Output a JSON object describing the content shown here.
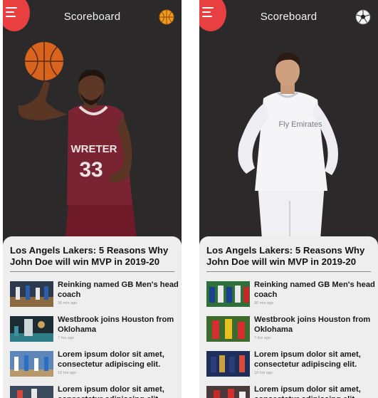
{
  "screens": [
    {
      "id": "left",
      "header": {
        "title": "Scoreboard",
        "sport_icon": "basketball-icon"
      },
      "hero": {
        "jersey_text": "WRETER",
        "jersey_number": "33"
      },
      "featured": {
        "headline": "Los Angels Lakers: 5 Reasons Why John Doe  will win MVP in 2019-20"
      },
      "news": [
        {
          "title": "Reinking named GB Men's head coach",
          "time": "30 min ago"
        },
        {
          "title": "Westbrook joins Houston from Oklohama",
          "time": "7 hrs ago"
        },
        {
          "title": "Lorem ipsum dolor sit amet, consectetur adipiscing elit.",
          "time": "10 hrs ago"
        },
        {
          "title": "Lorem ipsum dolor sit amet, consectetur adipiscing elit.",
          "time": ""
        }
      ],
      "colors": {
        "accent": "#e84040",
        "background": "#2b2929",
        "card": "#efeeee"
      }
    },
    {
      "id": "right",
      "header": {
        "title": "Scoreboard",
        "sport_icon": "soccer-ball-icon"
      },
      "hero": {
        "jersey_text": "Fly Emirates"
      },
      "featured": {
        "headline": "Los Angels Lakers: 5 Reasons Why John Doe  will win MVP in 2019-20"
      },
      "news": [
        {
          "title": "Reinking named GB Men's head coach",
          "time": "30 min ago"
        },
        {
          "title": "Westbrook joins Houston from Oklohama",
          "time": "7 hrs ago"
        },
        {
          "title": "Lorem ipsum dolor sit amet, consectetur adipiscing elit.",
          "time": "10 hrs ago"
        },
        {
          "title": "Lorem ipsum dolor sit amet, consectetur adipiscing elit.",
          "time": ""
        }
      ],
      "colors": {
        "accent": "#e84040",
        "background": "#2b2929",
        "card": "#efeeee"
      }
    }
  ]
}
